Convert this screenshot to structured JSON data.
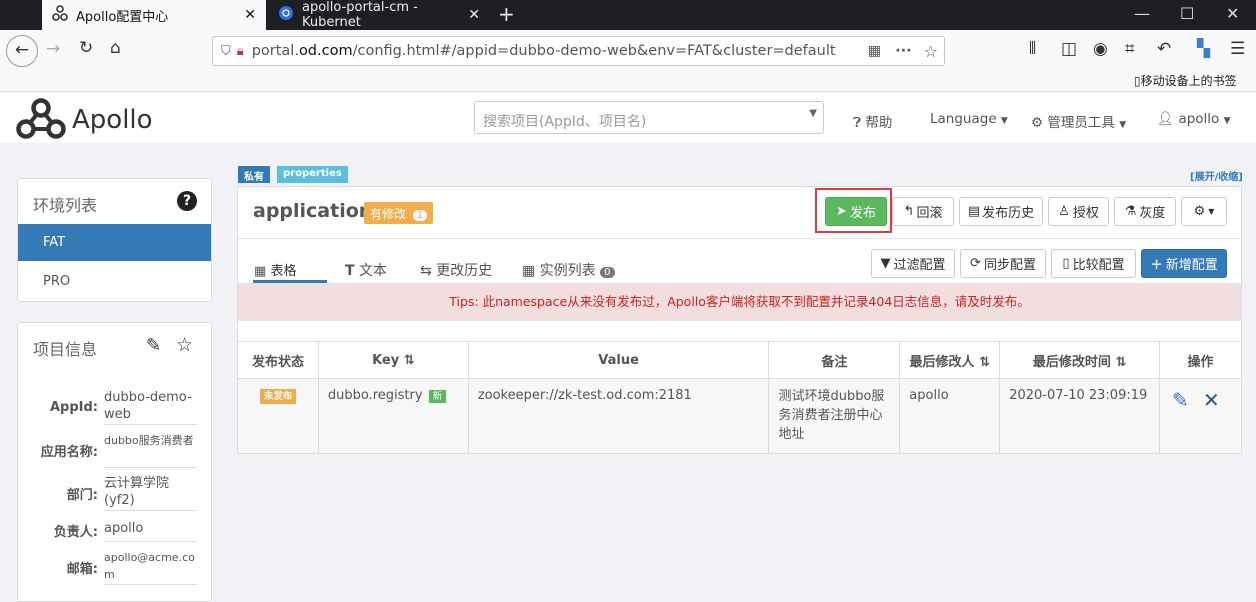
{
  "browser": {
    "tabs": [
      {
        "title": "Apollo配置中心",
        "close": "✕"
      },
      {
        "title": "apollo-portal-cm - Kubernet",
        "close": "✕"
      }
    ],
    "new_tab": "+",
    "url_prefix": "portal.",
    "url_domain": "od.com",
    "url_path": "/config.html#/appid=dubbo-demo-web&env=FAT&cluster=default",
    "mobile_bookmarks": "移动设备上的书签"
  },
  "header": {
    "logo": "Apollo",
    "search_placeholder": "搜索项目(AppId、项目名)",
    "help": "帮助",
    "language": "Language",
    "admin": "管理员工具",
    "user": "apollo"
  },
  "env": {
    "title": "环境列表",
    "items": [
      "FAT",
      "PRO"
    ]
  },
  "info": {
    "title": "项目信息",
    "rows": [
      {
        "label": "AppId:",
        "value": "dubbo-demo-web"
      },
      {
        "label": "应用名称:",
        "value": "dubbo服务消费者"
      },
      {
        "label": "部门:",
        "value": "云计算学院(yf2)"
      },
      {
        "label": "负责人:",
        "value": "apollo"
      },
      {
        "label": "邮箱:",
        "value": "apollo@acme.com"
      }
    ]
  },
  "namespace": {
    "badge_private": "私有",
    "badge_format": "properties",
    "expand": "[展开/收缩]",
    "name": "application",
    "modified": "有修改",
    "modified_count": "1",
    "actions": {
      "publish": "发布",
      "rollback": "回滚",
      "history": "发布历史",
      "auth": "授权",
      "gray": "灰度"
    },
    "tabs": {
      "table": "表格",
      "text": "文本",
      "history": "更改历史",
      "instances": "实例列表",
      "instances_count": "0"
    },
    "tools": {
      "filter": "过滤配置",
      "sync": "同步配置",
      "compare": "比较配置",
      "add": "新增配置"
    },
    "tips": "Tips: 此namespace从来没有发布过，Apollo客户端将获取不到配置并记录404日志信息，请及时发布。",
    "columns": [
      "发布状态",
      "Key",
      "Value",
      "备注",
      "最后修改人",
      "最后修改时间",
      "操作"
    ],
    "rows": [
      {
        "status": "未发布",
        "key": "dubbo.registry",
        "key_badge": "新",
        "value": "zookeeper://zk-test.od.com:2181",
        "comment": "测试环境dubbo服务消费者注册中心地址",
        "modifier": "apollo",
        "time": "2020-07-10 23:09:19"
      }
    ]
  },
  "colors": {
    "primary": "#337ab7",
    "success": "#5cb85c",
    "warning": "#f0ad4e",
    "info": "#5bc0de",
    "danger": "#cc2222",
    "highlight": "#e03b3b"
  }
}
